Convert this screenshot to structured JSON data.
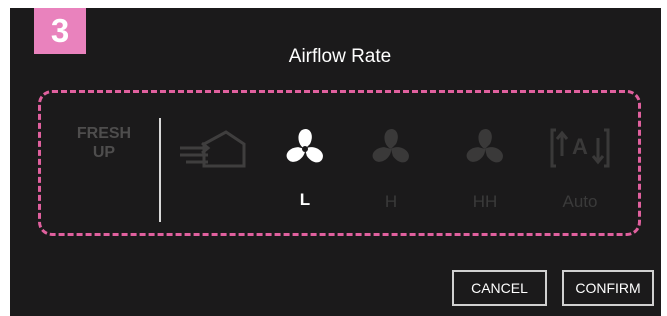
{
  "step": {
    "number": "3"
  },
  "header": {
    "title": "Airflow Rate"
  },
  "fresh_up": {
    "line1": "FRESH",
    "line2": "UP"
  },
  "modes": [
    {
      "icon": "fresh-air-house-icon",
      "label": ""
    },
    {
      "icon": "fan-icon",
      "label": "L",
      "selected": true
    },
    {
      "icon": "fan-icon",
      "label": "H"
    },
    {
      "icon": "fan-icon",
      "label": "HH"
    },
    {
      "icon": "auto-icon",
      "label": "Auto"
    }
  ],
  "auto_icon_text": "A",
  "buttons": {
    "cancel": "CANCEL",
    "confirm": "CONFIRM"
  },
  "colors": {
    "accent": "#e982bd",
    "frame": "#e0609e",
    "background": "#1b1a1b"
  }
}
